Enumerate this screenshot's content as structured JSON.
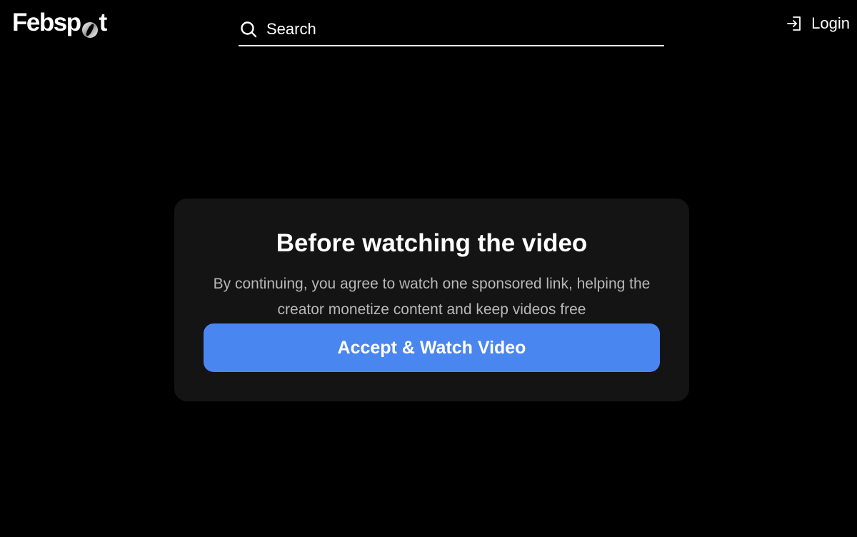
{
  "header": {
    "logo": {
      "prefix": "Febsp",
      "suffix": "t"
    },
    "search": {
      "placeholder": "Search",
      "value": ""
    },
    "login_label": "Login"
  },
  "icons": {
    "search": "search-icon",
    "login": "login-icon",
    "logo_o": "logo-o-icon"
  },
  "modal": {
    "title": "Before watching the video",
    "description": "By continuing, you agree to watch one sponsored link, helping the creator monetize content and keep videos free",
    "accept_button_label": "Accept & Watch Video"
  },
  "colors": {
    "background": "#000000",
    "card": "#141414",
    "accent": "#4a86f0",
    "muted_text": "#b8b8b8"
  }
}
